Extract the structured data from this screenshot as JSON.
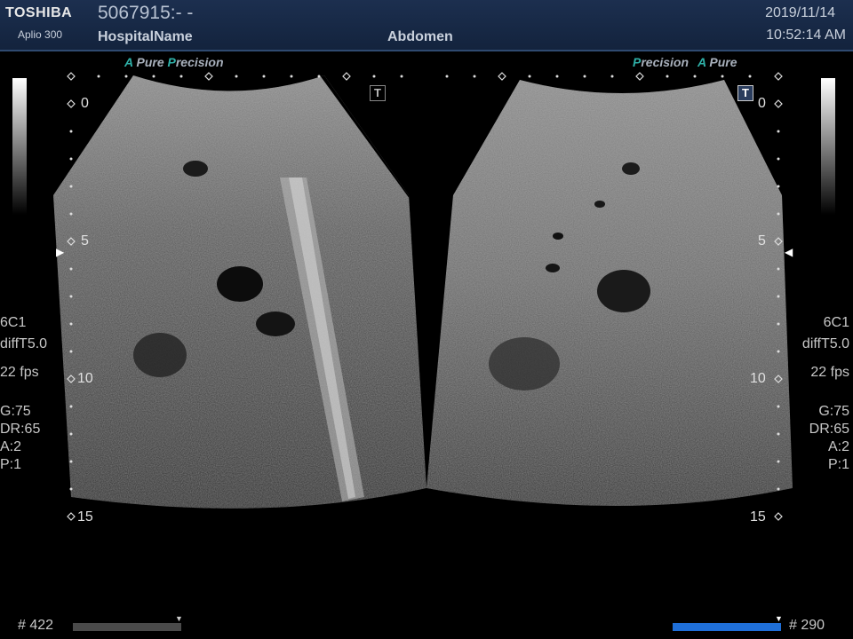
{
  "header": {
    "brand": "TOSHIBA",
    "model": "Aplio 300",
    "patient_id": "5067915:- -",
    "hospital": "HospitalName",
    "exam": "Abdomen",
    "date": "2019/11/14",
    "time": "10:52:14 AM"
  },
  "left_panel": {
    "tag": {
      "a": "A",
      "pure": "Pure",
      "p": "P",
      "precision": "recision"
    },
    "depths": [
      "0",
      "5",
      "10",
      "15"
    ],
    "params": {
      "probe": "6C1",
      "mode": "diffT5.0",
      "fps": "22 fps",
      "gain": "G:75",
      "dr": "DR:65",
      "a": "A:2",
      "p": "P:1"
    },
    "counter": "# 422",
    "cine_progress": 1.0,
    "t_label": "T"
  },
  "right_panel": {
    "tag": {
      "p": "P",
      "precision": "recision",
      "a": "A",
      "pure": "Pure"
    },
    "depths": [
      "0",
      "5",
      "10",
      "15"
    ],
    "params": {
      "probe": "6C1",
      "mode": "diffT5.0",
      "fps": "22 fps",
      "gain": "G:75",
      "dr": "DR:65",
      "a": "A:2",
      "p": "P:1"
    },
    "counter": "# 290",
    "cine_progress": 1.0,
    "t_label": "T"
  },
  "colors": {
    "accent": "#2fb0a8",
    "header_bg": "#1c2f4f",
    "cine_bar_active": "#1f6fd8",
    "cine_bar_inactive": "#4a4a4a"
  }
}
